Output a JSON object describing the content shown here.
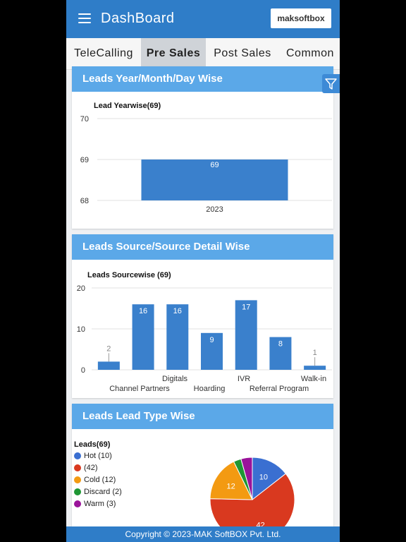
{
  "app": {
    "title": "DashBoard",
    "logo_text": "maksoftbox"
  },
  "tabs": [
    {
      "label": "TeleCalling"
    },
    {
      "label": "Pre Sales"
    },
    {
      "label": "Post Sales"
    },
    {
      "label": "Common"
    }
  ],
  "cards": {
    "year": {
      "header": "Leads Year/Month/Day Wise",
      "chart_title": "Lead Yearwise(69)"
    },
    "source": {
      "header": "Leads Source/Source Detail Wise",
      "chart_title": "Leads Sourcewise (69)"
    },
    "leadtype": {
      "header": "Leads Lead Type Wise",
      "chart_title": "Leads(69)"
    }
  },
  "icons": {
    "menu": "hamburger-menu-icon",
    "filter": "funnel-filter-icon"
  },
  "colors": {
    "appbar": "#2f7dc8",
    "card_header": "#5ba8e8",
    "bar": "#3a80cc"
  },
  "footer": {
    "text": "Copyright © 2023-MAK SoftBOX Pvt. Ltd."
  },
  "chart_data": [
    {
      "type": "bar",
      "title": "Lead Yearwise(69)",
      "categories": [
        "2023"
      ],
      "values": [
        69
      ],
      "data_labels": [
        "69"
      ],
      "ylim": [
        68,
        70
      ],
      "yticks": [
        "68",
        "69",
        "70"
      ],
      "grid": true
    },
    {
      "type": "bar",
      "title": "Leads Sourcewise (69)",
      "categories": [
        "Channel Partners",
        "Digitals",
        "Hoarding",
        "IVR",
        "Referral Program",
        "Walk-in"
      ],
      "values": [
        2,
        16,
        16,
        9,
        17,
        8,
        1
      ],
      "data_labels": [
        "2",
        "16",
        "16",
        "9",
        "17",
        "8",
        "1"
      ],
      "visible_tick_labels": [
        "Digitals",
        "Channel Partners",
        "Hoarding",
        "IVR",
        "Referral Program",
        "Walk-in"
      ],
      "ylim": [
        0,
        20
      ],
      "yticks": [
        "0",
        "10",
        "20"
      ],
      "grid": true
    },
    {
      "type": "pie",
      "title": "Leads(69)",
      "legend": [
        {
          "label": "Hot (10)",
          "value": 10,
          "color": "#3a6fd1"
        },
        {
          "label": "(42)",
          "value": 42,
          "color": "#d9391f"
        },
        {
          "label": "Cold (12)",
          "value": 12,
          "color": "#f39a12"
        },
        {
          "label": "Discard (2)",
          "value": 2,
          "color": "#1e9634"
        },
        {
          "label": "Warm (3)",
          "value": 3,
          "color": "#9a139a"
        }
      ],
      "slice_labels": [
        "10",
        "42",
        "12"
      ],
      "legend_position": "left"
    }
  ]
}
